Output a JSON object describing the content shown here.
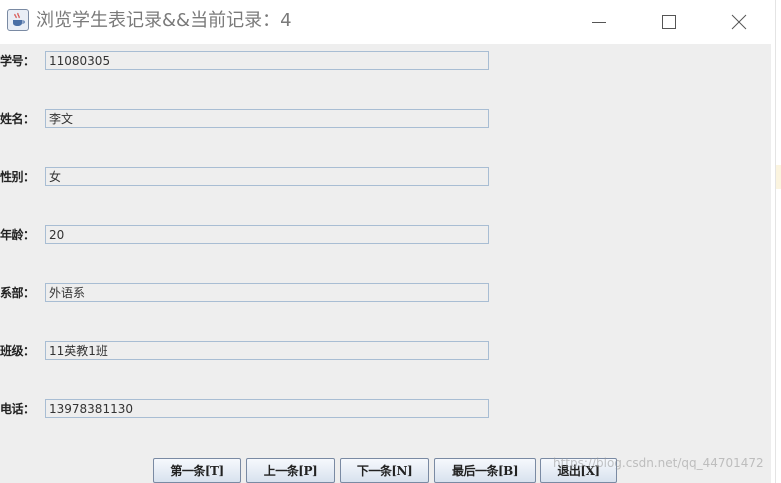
{
  "window": {
    "title": "浏览学生表记录&&当前记录：4"
  },
  "fields": [
    {
      "label": "学号：",
      "value": "11080305"
    },
    {
      "label": "姓名：",
      "value": "李文"
    },
    {
      "label": "性别：",
      "value": "女"
    },
    {
      "label": "年龄：",
      "value": "20"
    },
    {
      "label": "系部：",
      "value": "外语系"
    },
    {
      "label": "班级：",
      "value": "11英教1班"
    },
    {
      "label": "电话：",
      "value": "13978381130"
    }
  ],
  "buttons": {
    "first": "第一条[T]",
    "prev": "上一条[P]",
    "next": "下一条[N]",
    "last": "最后一条[B]",
    "exit": "退出[X]"
  },
  "watermark": "https://blog.csdn.net/qq_44701472",
  "icons": {
    "app": "java-cup-icon",
    "minimize": "minimize-icon",
    "maximize": "maximize-icon",
    "close": "close-icon"
  }
}
